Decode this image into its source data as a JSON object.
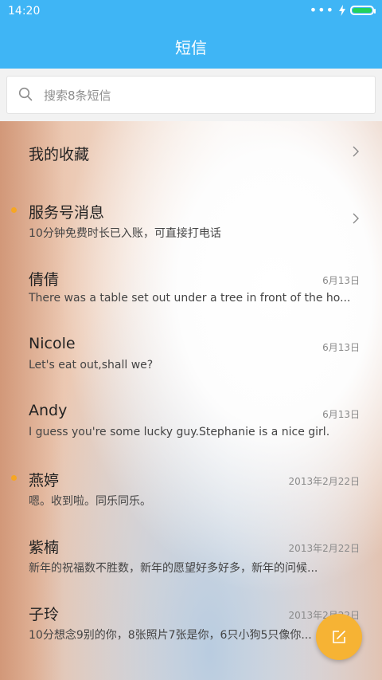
{
  "status_bar": {
    "time": "14:20",
    "icons": [
      "more-dots-icon",
      "charging-bolt-icon",
      "battery-icon"
    ]
  },
  "header": {
    "title": "短信"
  },
  "search": {
    "placeholder": "搜索8条短信",
    "icon": "search-icon"
  },
  "list": [
    {
      "name": "我的收藏",
      "preview": "",
      "date": "",
      "unread": false,
      "chevron": true
    },
    {
      "name": "服务号消息",
      "preview": "10分钟免费时长已入账，可直接打电话",
      "date": "",
      "unread": true,
      "chevron": true
    },
    {
      "name": "倩倩",
      "preview": "There was a table set out under a tree in front of the ho...",
      "date": "6月13日",
      "unread": false,
      "chevron": false
    },
    {
      "name": "Nicole",
      "preview": "Let's eat out,shall we?",
      "date": "6月13日",
      "unread": false,
      "chevron": false
    },
    {
      "name": "Andy",
      "preview": "I guess you're some lucky guy.Stephanie is a nice girl.",
      "date": "6月13日",
      "unread": false,
      "chevron": false
    },
    {
      "name": "燕婷",
      "preview": "嗯。收到啦。同乐同乐。",
      "date": "2013年2月22日",
      "unread": true,
      "chevron": false
    },
    {
      "name": "紫楠",
      "preview": "新年的祝福数不胜数，新年的愿望好多好多，新年的问候...",
      "date": "2013年2月22日",
      "unread": false,
      "chevron": false
    },
    {
      "name": "子玲",
      "preview": "10分想念9别的你，8张照片7张是你，6只小狗5只像你...",
      "date": "2013年2月22日",
      "unread": false,
      "chevron": false
    }
  ],
  "fab": {
    "icon": "compose-icon"
  },
  "colors": {
    "header": "#3fb5f5",
    "accent": "#f6a623",
    "battery": "#22d15c"
  }
}
